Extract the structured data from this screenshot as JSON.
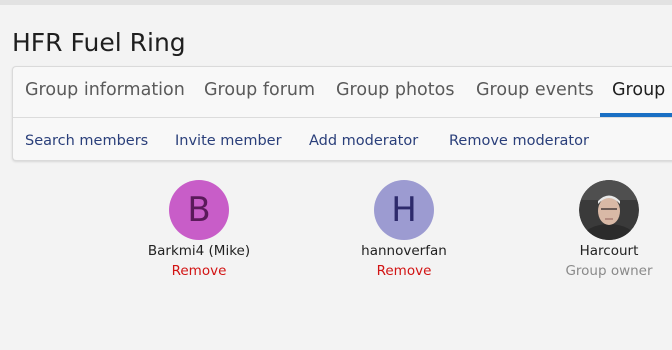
{
  "page": {
    "title": "HFR Fuel Ring"
  },
  "tabs": [
    {
      "label": "Group information"
    },
    {
      "label": "Group forum"
    },
    {
      "label": "Group photos"
    },
    {
      "label": "Group events"
    },
    {
      "label": "Group m",
      "active": true
    }
  ],
  "subnav": [
    {
      "label": "Search members"
    },
    {
      "label": "Invite member"
    },
    {
      "label": "Add moderator"
    },
    {
      "label": "Remove moderator"
    }
  ],
  "members": [
    {
      "initial": "B",
      "name": "Barkmi4 (Mike)",
      "action": "Remove",
      "avatar_bg": "#c85dc8",
      "avatar_fg": "#5a1a5a"
    },
    {
      "initial": "H",
      "name": "hannoverfan",
      "action": "Remove",
      "avatar_bg": "#9c9bd1",
      "avatar_fg": "#2d2a6b"
    },
    {
      "name": "Harcourt",
      "role": "Group owner",
      "avatar": "photo"
    }
  ],
  "colors": {
    "accent": "#1a6fc4",
    "link": "#2a3f7a",
    "danger": "#d21414"
  }
}
